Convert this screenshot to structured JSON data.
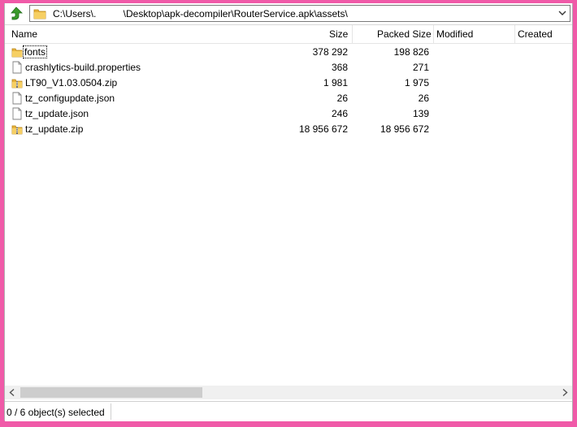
{
  "address": {
    "path": "C:\\Users\\.          \\Desktop\\apk-decompiler\\RouterService.apk\\assets\\"
  },
  "columns": {
    "name": "Name",
    "size": "Size",
    "packed": "Packed Size",
    "modified": "Modified",
    "created": "Created"
  },
  "files": [
    {
      "name": "fonts",
      "type": "folder",
      "size": "378 292",
      "packed": "198 826"
    },
    {
      "name": "crashlytics-build.properties",
      "type": "file",
      "size": "368",
      "packed": "271"
    },
    {
      "name": "LT90_V1.03.0504.zip",
      "type": "zip",
      "size": "1 981",
      "packed": "1 975"
    },
    {
      "name": "tz_configupdate.json",
      "type": "file",
      "size": "26",
      "packed": "26"
    },
    {
      "name": "tz_update.json",
      "type": "file",
      "size": "246",
      "packed": "139"
    },
    {
      "name": "tz_update.zip",
      "type": "zip",
      "size": "18 956 672",
      "packed": "18 956 672"
    }
  ],
  "status": {
    "text": "0 / 6 object(s) selected"
  },
  "colors": {
    "background": "#f05aa8",
    "folder": "#e8b33c",
    "up_arrow": "#3a9a2a"
  }
}
